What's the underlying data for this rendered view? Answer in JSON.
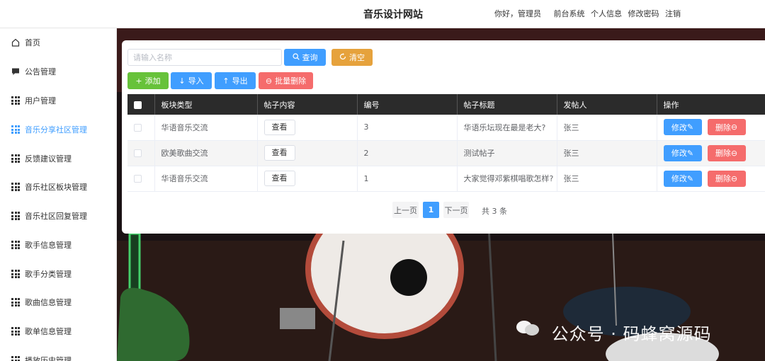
{
  "header": {
    "title": "音乐设计网站",
    "greeting": "你好，管理员",
    "links": [
      "前台系统",
      "个人信息",
      "修改密码",
      "注销"
    ]
  },
  "sidebar": {
    "active_color": "#409eff",
    "items": [
      {
        "label": "首页",
        "icon": "home-icon"
      },
      {
        "label": "公告管理",
        "icon": "message-icon"
      },
      {
        "label": "用户管理",
        "icon": "grid-icon"
      },
      {
        "label": "音乐分享社区管理",
        "icon": "grid-icon",
        "active": true
      },
      {
        "label": "反馈建议管理",
        "icon": "grid-icon"
      },
      {
        "label": "音乐社区板块管理",
        "icon": "grid-icon"
      },
      {
        "label": "音乐社区回复管理",
        "icon": "grid-icon"
      },
      {
        "label": "歌手信息管理",
        "icon": "grid-icon"
      },
      {
        "label": "歌手分类管理",
        "icon": "grid-icon"
      },
      {
        "label": "歌曲信息管理",
        "icon": "grid-icon"
      },
      {
        "label": "歌单信息管理",
        "icon": "grid-icon"
      },
      {
        "label": "播放历史管理",
        "icon": "grid-icon"
      }
    ]
  },
  "search": {
    "placeholder": "请输入名称",
    "value": "",
    "query_label": "查询",
    "clear_label": "清空"
  },
  "toolbar": {
    "add_label": "添加",
    "import_label": "导入",
    "export_label": "导出",
    "batch_delete_label": "批量删除"
  },
  "colors": {
    "primary": "#409eff",
    "warning": "#e6a23c",
    "success": "#67c23a",
    "danger": "#f56c6c",
    "table_header": "#2b2b2b"
  },
  "table": {
    "columns": [
      "板块类型",
      "帖子内容",
      "编号",
      "帖子标题",
      "发帖人",
      "操作"
    ],
    "view_label": "查看",
    "edit_label": "修改",
    "delete_label": "删除",
    "rows": [
      {
        "section": "华语音乐交流",
        "id": "3",
        "title": "华语乐坛现在最是老大?",
        "author": "张三"
      },
      {
        "section": "欧美歌曲交流",
        "id": "2",
        "title": "测试帖子",
        "author": "张三"
      },
      {
        "section": "华语音乐交流",
        "id": "1",
        "title": "大家觉得邓紫棋唱歌怎样?",
        "author": "张三"
      }
    ]
  },
  "pagination": {
    "prev_label": "上一页",
    "current_page": "1",
    "next_label": "下一页",
    "total_text": "共 3 条"
  },
  "watermark": {
    "text": "公众号 · 码蜂窝源码"
  }
}
